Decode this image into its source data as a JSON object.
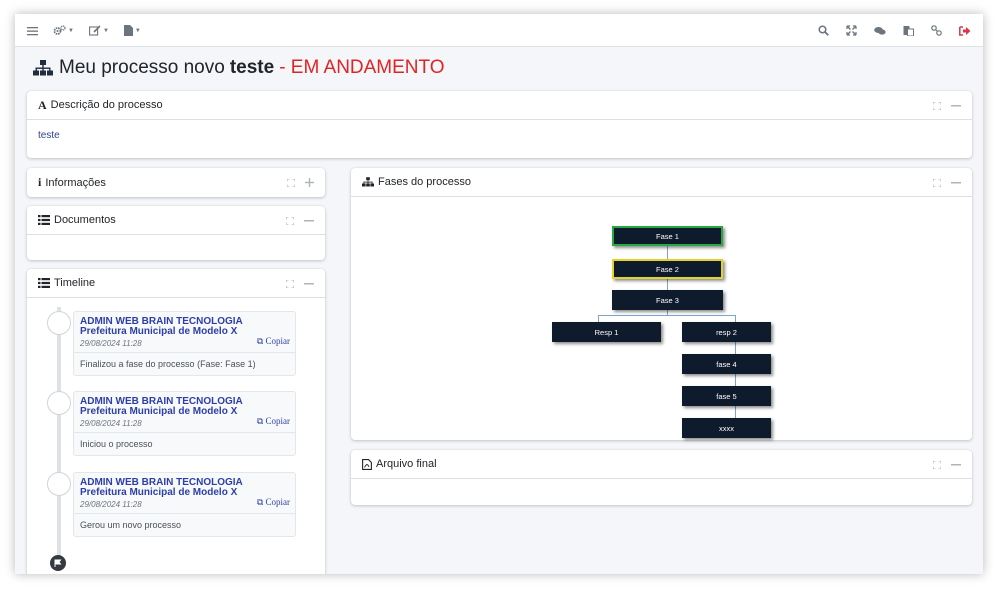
{
  "page": {
    "title_prefix": "Meu processo novo",
    "title_bold": "teste",
    "title_status": "- EM ANDAMENTO",
    "status_color": "#e02424"
  },
  "navbar": {
    "left_icons": [
      "menu-icon",
      "cogs-icon",
      "edit-icon",
      "file-icon"
    ],
    "right_icons": [
      "search-icon",
      "expand-icon",
      "comments-icon",
      "paste-icon",
      "link-icon",
      "logout-icon"
    ]
  },
  "descricao": {
    "title": "Descrição do processo",
    "text": "teste"
  },
  "informacoes": {
    "title": "Informações"
  },
  "documentos": {
    "title": "Documentos"
  },
  "timeline": {
    "title": "Timeline",
    "items": [
      {
        "name": "ADMIN WEB BRAIN TECNOLOGIA",
        "org": "Prefeitura Municipal de Modelo X",
        "date": "29/08/2024 11:28",
        "copy": "Copiar",
        "text": "Finalizou a fase do processo (Fase: Fase 1)"
      },
      {
        "name": "ADMIN WEB BRAIN TECNOLOGIA",
        "org": "Prefeitura Municipal de Modelo X",
        "date": "29/08/2024 11:28",
        "copy": "Copiar",
        "text": "Iniciou o processo"
      },
      {
        "name": "ADMIN WEB BRAIN TECNOLOGIA",
        "org": "Prefeitura Municipal de Modelo X",
        "date": "29/08/2024 11:28",
        "copy": "Copiar",
        "text": "Gerou um novo processo"
      }
    ]
  },
  "fases": {
    "title": "Fases do processo",
    "nodes": {
      "fase1": "Fase 1",
      "fase2": "Fase 2",
      "fase3": "Fase 3",
      "resp1": "Resp 1",
      "resp2": "resp 2",
      "fase4": "fase 4",
      "fase5": "fase 5",
      "xxxx": "xxxx"
    },
    "colors": {
      "completed": "#28a745",
      "current": "#e3d22b",
      "node": "#0e1b2c"
    }
  },
  "arquivo": {
    "title": "Arquivo final"
  }
}
